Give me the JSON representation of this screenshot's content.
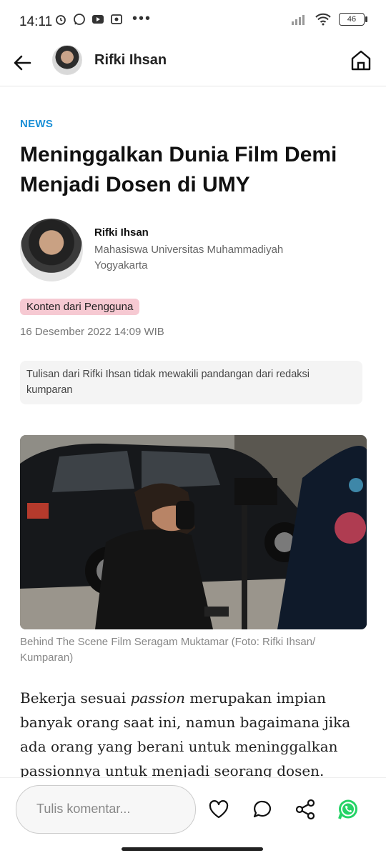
{
  "status_bar": {
    "time": "14:11",
    "battery": "46"
  },
  "header": {
    "name": "Rifki Ihsan"
  },
  "article": {
    "category": "NEWS",
    "title": "Meninggalkan Dunia Film Demi Menjadi Dosen di UMY",
    "author": {
      "name": "Rifki Ihsan",
      "description": "Mahasiswa Universitas Muhammadiyah Yogyakarta"
    },
    "badge": "Konten dari Pengguna",
    "date": "16 Desember 2022 14:09 WIB",
    "disclaimer": "Tulisan dari Rifki Ihsan tidak mewakili pandangan dari redaksi kumparan",
    "photo_caption": "Behind The Scene Film Seragam Muktamar (Foto: Rifki Ihsan/ Kumparan)",
    "body": {
      "part1": "Bekerja sesuai ",
      "emphasis": "passion",
      "part2": " merupakan impian banyak orang saat ini, namun bagaimana jika ada orang yang berani untuk meninggalkan passionnya untuk menjadi seorang dosen."
    }
  },
  "bottom_bar": {
    "comment_placeholder": "Tulis komentar...",
    "icons": [
      "heart-icon",
      "comment-icon",
      "share-icon",
      "whatsapp-icon"
    ]
  },
  "colors": {
    "category": "#1a8fd6",
    "badge_bg": "#f6c9d2",
    "whatsapp": "#25d366"
  }
}
